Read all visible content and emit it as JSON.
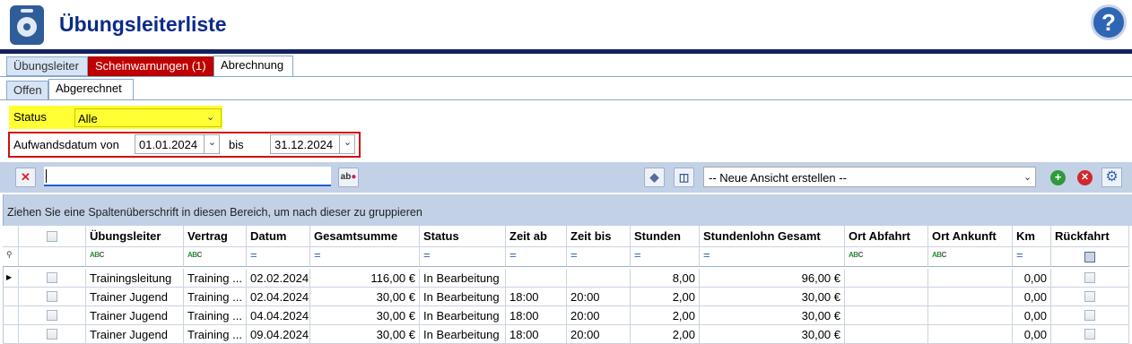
{
  "header": {
    "title": "Übungsleiterliste",
    "help_icon": "?"
  },
  "tabs": [
    {
      "label": "Übungsleiter",
      "active": false
    },
    {
      "label": "Scheinwarnungen (1)",
      "active": false,
      "color": "#c00000"
    },
    {
      "label": "Abrechnung",
      "active": true
    }
  ],
  "subtabs": [
    {
      "label": "Offen",
      "active": false
    },
    {
      "label": "Abgerechnet",
      "active": true
    }
  ],
  "filters": {
    "status_label": "Status",
    "status_value": "Alle",
    "date_label": "Aufwandsdatum von",
    "date_from": "01.01.2024",
    "bis_label": "bis",
    "date_to": "31.12.2024"
  },
  "toolbar": {
    "search_value": "",
    "view_select": "-- Neue Ansicht erstellen --"
  },
  "group_panel_text": "Ziehen Sie eine Spaltenüberschrift in diesen Bereich, um nach dieser zu gruppieren",
  "columns": [
    "Übungsleiter",
    "Vertrag",
    "Datum",
    "Gesamtsumme",
    "Status",
    "Zeit ab",
    "Zeit bis",
    "Stunden",
    "Stundenlohn Gesamt",
    "Ort Abfahrt",
    "Ort Ankunft",
    "Km",
    "Rückfahrt"
  ],
  "rows": [
    {
      "uebungsleiter": "Trainingsleitung",
      "vertrag": "Training ...",
      "datum": "02.02.2024",
      "gesamtsumme": "116,00 €",
      "status": "In Bearbeitung",
      "zeit_ab": "",
      "zeit_bis": "",
      "stunden": "8,00",
      "stundenlohn": "96,00 €",
      "ort_abfahrt": "",
      "ort_ankunft": "",
      "km": "0,00",
      "current": true
    },
    {
      "uebungsleiter": "Trainer Jugend",
      "vertrag": "Training ...",
      "datum": "02.04.2024",
      "gesamtsumme": "30,00 €",
      "status": "In Bearbeitung",
      "zeit_ab": "18:00",
      "zeit_bis": "20:00",
      "stunden": "2,00",
      "stundenlohn": "30,00 €",
      "ort_abfahrt": "",
      "ort_ankunft": "",
      "km": "0,00",
      "current": false
    },
    {
      "uebungsleiter": "Trainer Jugend",
      "vertrag": "Training ...",
      "datum": "04.04.2024",
      "gesamtsumme": "30,00 €",
      "status": "In Bearbeitung",
      "zeit_ab": "18:00",
      "zeit_bis": "20:00",
      "stunden": "2,00",
      "stundenlohn": "30,00 €",
      "ort_abfahrt": "",
      "ort_ankunft": "",
      "km": "0,00",
      "current": false
    },
    {
      "uebungsleiter": "Trainer Jugend",
      "vertrag": "Training ...",
      "datum": "09.04.2024",
      "gesamtsumme": "30,00 €",
      "status": "In Bearbeitung",
      "zeit_ab": "18:00",
      "zeit_bis": "20:00",
      "stunden": "2,00",
      "stundenlohn": "30,00 €",
      "ort_abfahrt": "",
      "ort_ankunft": "",
      "km": "0,00",
      "current": false
    }
  ],
  "colors": {
    "title": "#0a2a8a",
    "warning_tab": "#c00000",
    "status_highlight": "#ffff33",
    "date_border": "#d01010",
    "toolbar_bg": "#c2d1e6"
  }
}
